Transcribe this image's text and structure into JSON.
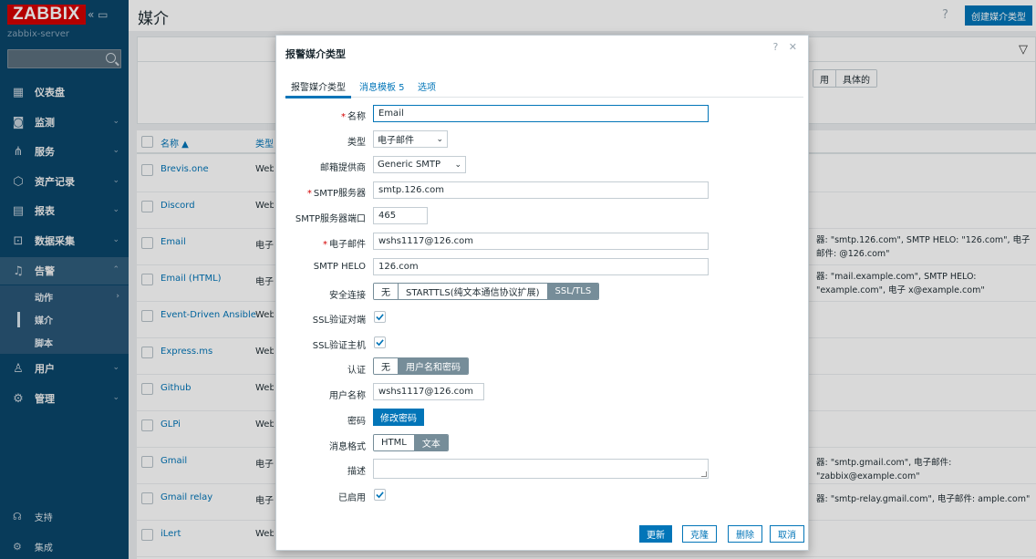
{
  "app": {
    "logo": "ZABBIX",
    "server": "zabbix-server",
    "collapse": "« ▭",
    "page_title": "媒介",
    "create_button": "创建媒介类型",
    "help": "?"
  },
  "sidebar": {
    "items": [
      {
        "label": "仪表盘",
        "icon": "dashboard-icon"
      },
      {
        "label": "监测",
        "icon": "monitoring-icon"
      },
      {
        "label": "服务",
        "icon": "services-icon"
      },
      {
        "label": "资产记录",
        "icon": "inventory-icon"
      },
      {
        "label": "报表",
        "icon": "reports-icon"
      },
      {
        "label": "数据采集",
        "icon": "data-collection-icon"
      },
      {
        "label": "告警",
        "icon": "alerts-icon"
      },
      {
        "label": "用户",
        "icon": "users-icon"
      },
      {
        "label": "管理",
        "icon": "administration-icon"
      }
    ],
    "sub": [
      {
        "label": "动作"
      },
      {
        "label": "媒介"
      },
      {
        "label": "脚本"
      }
    ],
    "footer": [
      {
        "label": "支持",
        "icon": "support-icon"
      },
      {
        "label": "集成",
        "icon": "integrations-icon"
      }
    ]
  },
  "filter": {
    "segments": [
      "用",
      "具体的"
    ]
  },
  "table": {
    "col_name": "名称 ▲",
    "col_type": "类型",
    "rows": [
      {
        "name": "Brevis.one",
        "type": "Webh"
      },
      {
        "name": "Discord",
        "type": "Webh"
      },
      {
        "name": "Email",
        "type": "电子邮",
        "detail": "器: \"smtp.126.com\", SMTP HELO: \"126.com\", 电子邮件: @126.com\""
      },
      {
        "name": "Email (HTML)",
        "type": "电子邮",
        "detail": "器: \"mail.example.com\", SMTP HELO: \"example.com\", 电子 x@example.com\""
      },
      {
        "name": "Event-Driven Ansible",
        "type": "Webh"
      },
      {
        "name": "Express.ms",
        "type": "Webh"
      },
      {
        "name": "Github",
        "type": "Webh"
      },
      {
        "name": "GLPi",
        "type": "Webh"
      },
      {
        "name": "Gmail",
        "type": "电子邮",
        "detail": "器: \"smtp.gmail.com\", 电子邮件: \"zabbix@example.com\""
      },
      {
        "name": "Gmail relay",
        "type": "电子邮",
        "detail": "器: \"smtp-relay.gmail.com\", 电子邮件: ample.com\""
      },
      {
        "name": "iLert",
        "type": "Webh"
      }
    ]
  },
  "dialog": {
    "title": "报警媒介类型",
    "controls": "? ✕",
    "tabs": [
      {
        "label": "报警媒介类型"
      },
      {
        "label": "消息模板 5"
      },
      {
        "label": "选项"
      }
    ],
    "form": {
      "name_label": "名称",
      "name_value": "Email",
      "type_label": "类型",
      "type_value": "电子邮件",
      "provider_label": "邮箱提供商",
      "provider_value": "Generic SMTP",
      "smtp_server_label": "SMTP服务器",
      "smtp_server_value": "smtp.126.com",
      "smtp_port_label": "SMTP服务器端口",
      "smtp_port_value": "465",
      "email_label": "电子邮件",
      "email_value": "wshs1117@126.com",
      "helo_label": "SMTP HELO",
      "helo_value": "126.com",
      "security_label": "安全连接",
      "security_options": [
        "无",
        "STARTTLS(纯文本通信协议扩展)",
        "SSL/TLS"
      ],
      "ssl_verify_peer_label": "SSL验证对端",
      "ssl_verify_host_label": "SSL验证主机",
      "auth_label": "认证",
      "auth_options": [
        "无",
        "用户名和密码"
      ],
      "username_label": "用户名称",
      "username_value": "wshs1117@126.com",
      "password_label": "密码",
      "password_button": "修改密码",
      "format_label": "消息格式",
      "format_options": [
        "HTML",
        "文本"
      ],
      "desc_label": "描述",
      "desc_value": "",
      "enabled_label": "已启用"
    },
    "buttons": {
      "update": "更新",
      "clone": "克隆",
      "delete": "删除",
      "cancel": "取消"
    }
  }
}
